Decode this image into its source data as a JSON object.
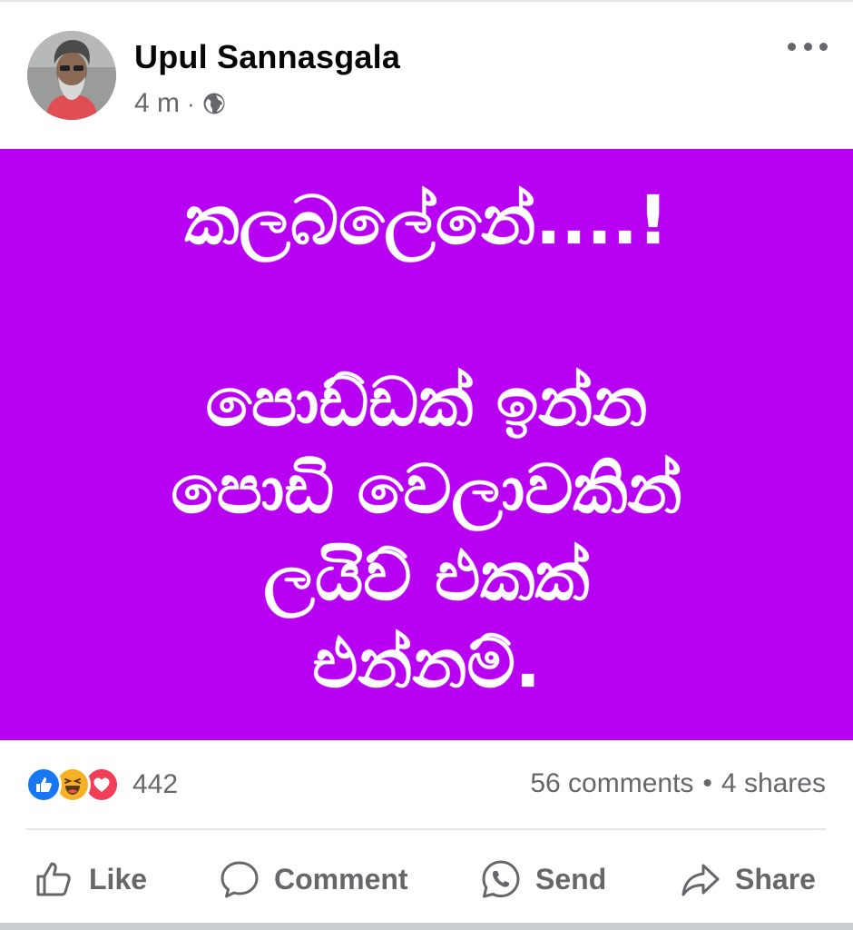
{
  "post": {
    "author": "Upul Sannasgala",
    "time": "4 m",
    "separator": "·",
    "privacy_icon": "globe-icon",
    "more_icon": "more-options-icon",
    "background_color": "#b800f2",
    "text_color": "#ffffff",
    "lines": [
      "කලබලේනේ....!",
      "පොඩ්ඩක් ඉන්න",
      "පොඩි වෙලාවකින්",
      "ලයිව් එකක්",
      "එන්නම්."
    ]
  },
  "reactions": {
    "icons": [
      "like-reaction-icon",
      "haha-reaction-icon",
      "love-reaction-icon"
    ],
    "count": "442",
    "comments": "56 comments",
    "dot": "•",
    "shares": "4 shares"
  },
  "actions": {
    "like": "Like",
    "comment": "Comment",
    "send": "Send",
    "share": "Share"
  },
  "colors": {
    "like_blue": "#1877f2",
    "haha_yellow": "#f7b125",
    "love_red": "#f33e58",
    "secondary_text": "#65676b"
  }
}
